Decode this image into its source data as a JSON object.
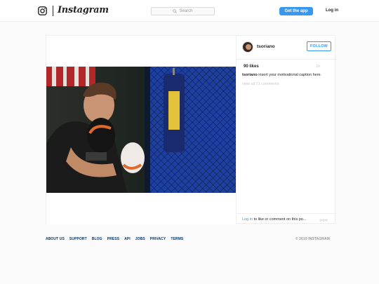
{
  "header": {
    "logo_icon": "instagram-camera-icon",
    "wordmark": "Instagram",
    "search_placeholder": "Search",
    "get_app_label": "Get the app",
    "login_label": "Log in",
    "accent": "#3897f0"
  },
  "post": {
    "username": "tsoriano",
    "follow_label": "FOLLOW",
    "likes": "90 likes",
    "time": "1h",
    "caption_user": "tsoriano",
    "caption_text": " insert your motivational caption here.",
    "view_comments": "view all 71 comments",
    "comment_prompt_link": "Log in",
    "comment_prompt_text": " to like or comment on this po...",
    "more_icon": "more-horizontal-icon",
    "photo_icon": "boxing-photo"
  },
  "footer": {
    "links": [
      "ABOUT US",
      "SUPPORT",
      "BLOG",
      "PRESS",
      "API",
      "JOBS",
      "PRIVACY",
      "TERMS"
    ],
    "copyright": "© 2019 INSTAGRAM"
  }
}
